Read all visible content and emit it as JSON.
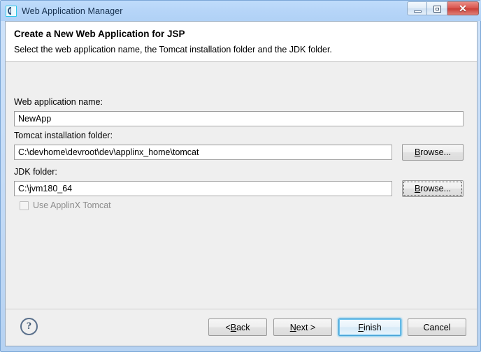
{
  "window": {
    "title": "Web Application Manager",
    "icon": "app-ring-icon",
    "controls": {
      "minimize": "minimize-icon",
      "restore": "restore-icon",
      "close": "✕"
    }
  },
  "header": {
    "title": "Create a New Web Application for JSP",
    "subtitle": "Select the web application name, the Tomcat installation folder and the JDK folder."
  },
  "form": {
    "app_name": {
      "label": "Web application name:",
      "value": "NewApp",
      "placeholder": ""
    },
    "tomcat": {
      "label": "Tomcat installation folder:",
      "value": "C:\\devhome\\devroot\\dev\\applinx_home\\tomcat",
      "placeholder": "",
      "browse_pre": "B",
      "browse_post": "rowse..."
    },
    "jdk": {
      "label": "JDK folder:",
      "value": "C:\\jvm180_64",
      "placeholder": "",
      "browse_pre": "B",
      "browse_post": "rowse..."
    },
    "use_applinx_tomcat": {
      "label": "Use ApplinX Tomcat",
      "checked": false,
      "enabled": false
    }
  },
  "footer": {
    "help": "?",
    "buttons": {
      "back_pre": "< ",
      "back_mnem": "B",
      "back_post": "ack",
      "next_mnem": "N",
      "next_post": "ext >",
      "finish_mnem": "F",
      "finish_post": "inish",
      "cancel": "Cancel"
    }
  },
  "colors": {
    "titlebar": "#b6d5f8",
    "client_bg": "#efefef",
    "header_bg": "#ffffff",
    "accent_default_button": "#4aa3d6",
    "close_button": "#c93e36",
    "disabled_text": "#8d8d8d"
  }
}
